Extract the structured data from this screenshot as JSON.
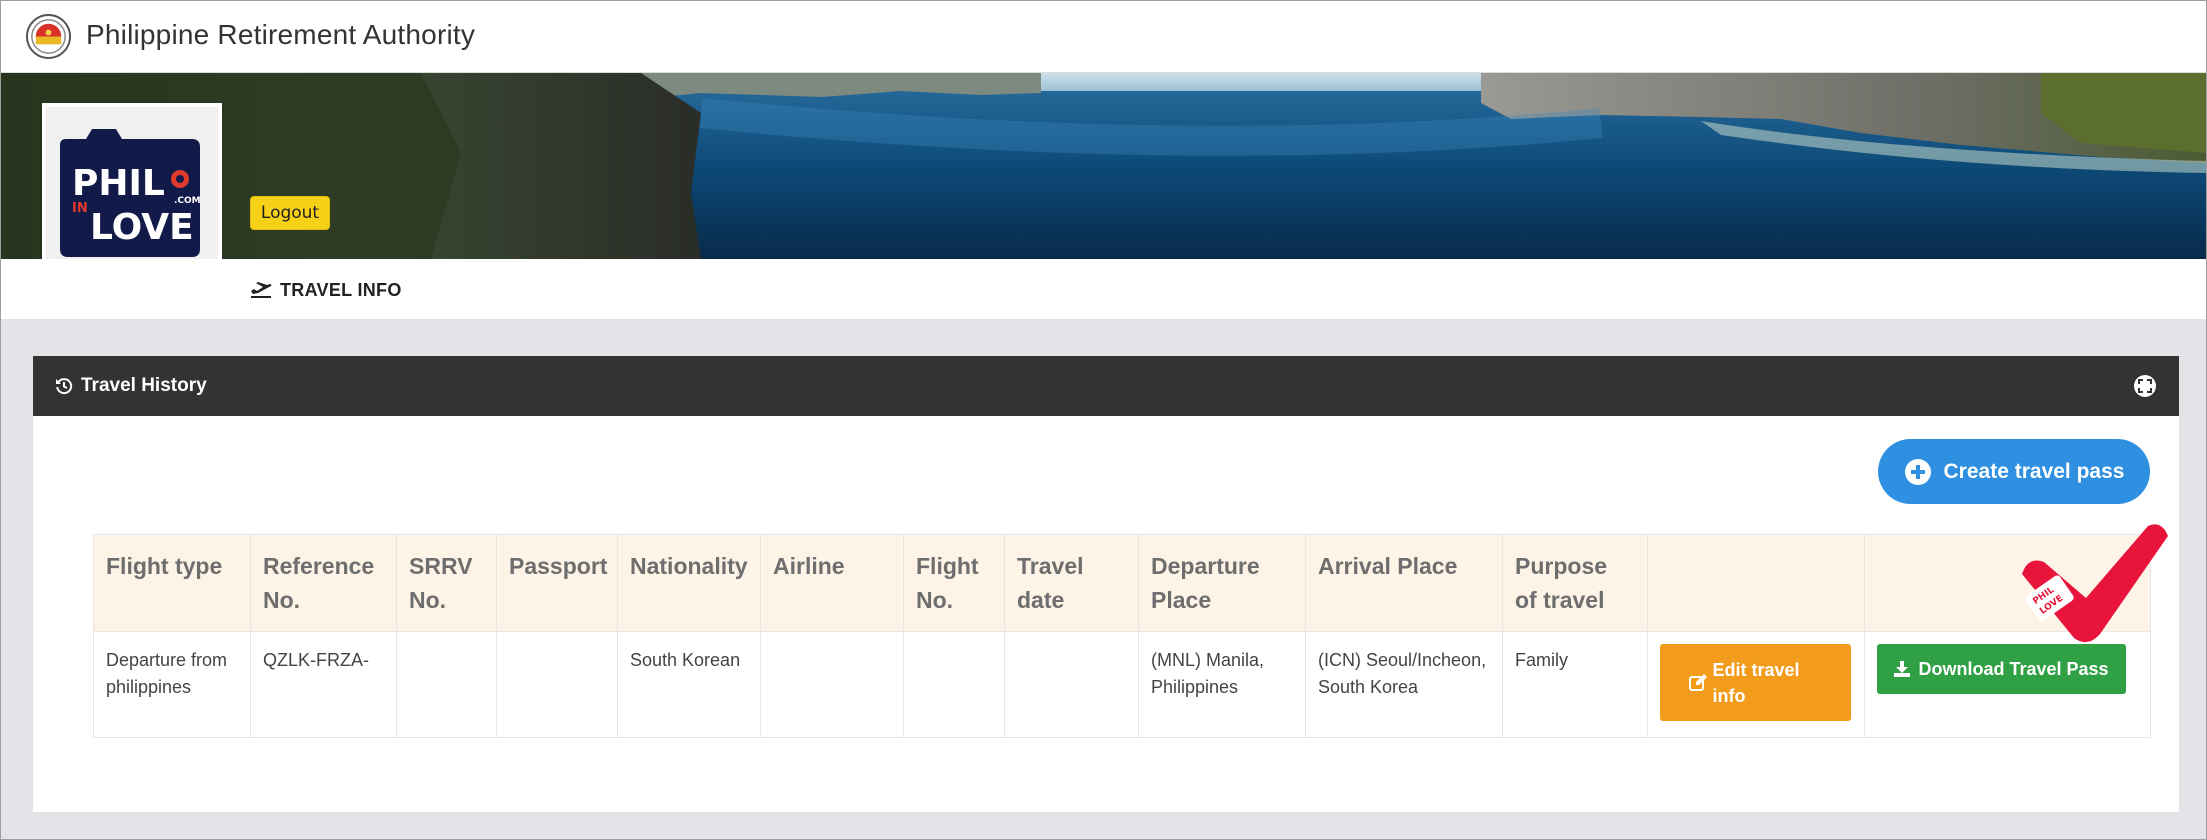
{
  "app": {
    "title": "Philippine Retirement Authority",
    "seal_icon": "pra-seal-icon"
  },
  "profile": {
    "logout_label": "Logout"
  },
  "tabs": {
    "travel_info_label": "TRAVEL INFO",
    "travel_info_icon": "airplane-departure-icon"
  },
  "panel": {
    "title": "Travel History",
    "history_icon": "history-icon",
    "fullscreen_icon": "expand-icon",
    "create_button_label": "Create travel pass"
  },
  "table": {
    "headers": [
      "Flight type",
      "Reference No.",
      "SRRV No.",
      "Passport",
      "Nationality",
      "Airline",
      "Flight No.",
      "Travel date",
      "Departure Place",
      "Arrival Place",
      "Purpose of travel",
      "",
      ""
    ],
    "rows": [
      {
        "flight_type": "Departure from philippines",
        "reference_no": "QZLK-FRZA-",
        "srrv_no": "",
        "passport": "",
        "nationality": "South Korean",
        "airline": "",
        "flight_no": "",
        "travel_date": "",
        "departure_place": "(MNL) Manila, Philippines",
        "arrival_place": "(ICN) Seoul/Incheon, South Korea",
        "purpose": "Family",
        "edit_label": "Edit travel info",
        "download_label": "Download Travel Pass"
      }
    ]
  },
  "colors": {
    "topbar_bg": "#ffffff",
    "panel_header_bg": "#333333",
    "create_button": "#2f8fe0",
    "edit_button": "#f39c1c",
    "download_button": "#30a045",
    "logout_button": "#f7d117",
    "table_header_bg": "#fdf3e7",
    "content_bg": "#e2e4e7"
  },
  "logo": {
    "text": "PHIL IN LOVE .COM"
  }
}
